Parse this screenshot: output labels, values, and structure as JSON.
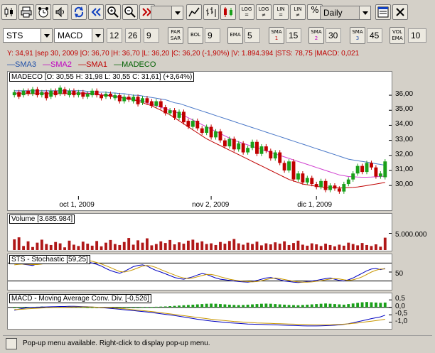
{
  "toolbar": {
    "period": "Daily",
    "zoom_value": "",
    "buttons": [
      {
        "name": "log-eq-button",
        "line1": "LOG",
        "line2": "="
      },
      {
        "name": "log-neq-button",
        "line1": "LOG",
        "line2": "≠"
      },
      {
        "name": "lin-eq-button",
        "line1": "LIN",
        "line2": "="
      },
      {
        "name": "lin-neq-button",
        "line1": "LIN",
        "line2": "≠"
      }
    ],
    "percent_label": "%"
  },
  "indicators": {
    "symbol": "STS",
    "macd_select": "MACD",
    "macd_p1": "12",
    "macd_p2": "26",
    "macd_p3": "9",
    "par_sar_l1": "PAR",
    "par_sar_l2": "SAR",
    "bol_label": "BOL",
    "bol_value": "9",
    "ema_label": "EMA",
    "ema_value": "5",
    "sma1_label": "SMA",
    "sma1_idx": "1",
    "sma1_value": "15",
    "sma2_label": "SMA",
    "sma2_idx": "2",
    "sma2_value": "30",
    "sma3_label": "SMA",
    "sma3_idx": "3",
    "sma3_value": "45",
    "vol_ema_l1": "VOL",
    "vol_ema_l2": "EMA",
    "vol_ema_value": "10"
  },
  "info_line": "Y: 34,91 |sep 30, 2009 |O: 36,70 |H: 36,70 |L: 36,20 |C: 36,20 (-1,90%) |V: 1.894.394 |STS: 78,75 |MACD: 0,021",
  "legend": [
    {
      "label": "—SMA3",
      "color": "#1f4fa8"
    },
    {
      "label": "—SMA2",
      "color": "#c000c0"
    },
    {
      "label": "—SMA1",
      "color": "#c00000"
    },
    {
      "label": "—MADECO",
      "color": "#006000"
    }
  ],
  "colors": {
    "up": "#1aa01a",
    "down": "#c00000",
    "sma3": "#4a78c8",
    "sma2": "#d040d0",
    "sma1": "#c00000"
  },
  "chart_data": [
    {
      "type": "candlestick",
      "title": "MADECO [O: 30,55  H: 31,98  L: 30,55  C: 31,61] (+3,64%)",
      "ylim": [
        29.3,
        36.9
      ],
      "yticks": [
        "36,00",
        "35,00",
        "34,00",
        "33,00",
        "32,00",
        "31,00",
        "30,00"
      ],
      "ytick_values": [
        36,
        35,
        34,
        33,
        32,
        31,
        30
      ],
      "xticks": [
        "oct 1, 2009",
        "nov 2, 2009",
        "dic 1, 2009"
      ],
      "xtick_index": [
        14,
        43,
        66
      ],
      "close": [
        36.2,
        35.9,
        36.3,
        36.1,
        36.4,
        36.0,
        36.2,
        35.8,
        36.3,
        36.0,
        36.5,
        36.1,
        36.3,
        36.0,
        36.2,
        35.9,
        36.1,
        36.3,
        36.0,
        35.8,
        36.1,
        35.9,
        36.0,
        35.6,
        35.9,
        35.7,
        35.9,
        35.4,
        35.8,
        35.5,
        35.3,
        35.6,
        35.2,
        34.8,
        35.0,
        34.5,
        34.9,
        34.2,
        33.9,
        34.3,
        33.8,
        33.5,
        33.9,
        33.2,
        33.6,
        33.0,
        32.6,
        33.1,
        32.4,
        32.8,
        32.2,
        32.5,
        32.9,
        32.1,
        32.6,
        32.3,
        31.8,
        32.2,
        31.5,
        31.0,
        31.6,
        30.4,
        30.8,
        30.2,
        30.5,
        30.1,
        29.9,
        30.3,
        29.7,
        30.0,
        29.8,
        29.6,
        30.1,
        30.4,
        30.8,
        31.3,
        30.9,
        31.5,
        31.2,
        30.6,
        30.8,
        31.6
      ],
      "open": [
        36.0,
        36.2,
        36.0,
        36.3,
        36.1,
        36.4,
        36.0,
        36.2,
        35.9,
        36.3,
        36.1,
        36.4,
        36.0,
        36.3,
        36.0,
        36.2,
        35.9,
        36.0,
        36.3,
        36.0,
        35.9,
        36.1,
        35.8,
        36.0,
        35.6,
        35.9,
        35.6,
        35.9,
        35.5,
        35.8,
        35.6,
        35.3,
        35.6,
        35.2,
        34.8,
        35.0,
        34.5,
        34.9,
        34.3,
        33.9,
        34.3,
        33.8,
        33.5,
        33.9,
        33.2,
        33.6,
        33.0,
        32.6,
        33.1,
        32.4,
        32.8,
        32.2,
        32.5,
        32.9,
        32.1,
        32.6,
        32.3,
        31.8,
        32.2,
        31.5,
        31.0,
        31.6,
        30.4,
        30.8,
        30.2,
        30.5,
        30.1,
        29.9,
        30.3,
        29.7,
        30.0,
        29.8,
        29.6,
        30.1,
        30.4,
        30.8,
        31.3,
        30.9,
        31.5,
        31.2,
        30.6,
        30.55
      ],
      "series": [
        {
          "name": "SMA3",
          "values": [
            36.3,
            36.3,
            36.3,
            36.3,
            36.3,
            36.3,
            36.3,
            36.3,
            36.3,
            36.3,
            36.3,
            36.3,
            36.3,
            36.3,
            36.3,
            36.3,
            36.25,
            36.25,
            36.2,
            36.2,
            36.2,
            36.15,
            36.15,
            36.1,
            36.1,
            36.05,
            36.0,
            36.0,
            35.95,
            35.9,
            35.85,
            35.8,
            35.75,
            35.7,
            35.6,
            35.5,
            35.45,
            35.35,
            35.25,
            35.15,
            35.05,
            34.95,
            34.85,
            34.75,
            34.65,
            34.55,
            34.45,
            34.35,
            34.25,
            34.15,
            34.05,
            33.95,
            33.85,
            33.75,
            33.65,
            33.55,
            33.45,
            33.35,
            33.25,
            33.15,
            33.05,
            32.95,
            32.85,
            32.75,
            32.65,
            32.55,
            32.45,
            32.35,
            32.25,
            32.15,
            32.05,
            31.95,
            31.85,
            31.75,
            31.7,
            31.65,
            31.6,
            31.55,
            31.5,
            31.45,
            31.4,
            31.35
          ]
        },
        {
          "name": "SMA2",
          "values": [
            36.2,
            36.2,
            36.2,
            36.2,
            36.2,
            36.2,
            36.2,
            36.2,
            36.2,
            36.2,
            36.2,
            36.2,
            36.2,
            36.2,
            36.2,
            36.15,
            36.15,
            36.1,
            36.1,
            36.05,
            36.0,
            36.0,
            35.95,
            35.9,
            35.85,
            35.8,
            35.75,
            35.7,
            35.6,
            35.5,
            35.4,
            35.3,
            35.2,
            35.1,
            35.0,
            34.9,
            34.8,
            34.65,
            34.5,
            34.35,
            34.2,
            34.05,
            33.9,
            33.75,
            33.6,
            33.45,
            33.3,
            33.15,
            33.0,
            32.9,
            32.8,
            32.7,
            32.6,
            32.5,
            32.4,
            32.3,
            32.2,
            32.1,
            32.0,
            31.9,
            31.8,
            31.7,
            31.6,
            31.5,
            31.4,
            31.3,
            31.2,
            31.1,
            31.0,
            30.9,
            30.8,
            30.7,
            30.65,
            30.6,
            30.58,
            30.56,
            30.55,
            30.55,
            30.56,
            30.58,
            30.6,
            30.62
          ]
        },
        {
          "name": "SMA1",
          "values": [
            36.1,
            36.1,
            36.1,
            36.1,
            36.1,
            36.1,
            36.1,
            36.1,
            36.1,
            36.1,
            36.1,
            36.1,
            36.1,
            36.1,
            36.1,
            36.1,
            36.1,
            36.1,
            36.05,
            36.0,
            36.0,
            35.95,
            35.9,
            35.85,
            35.8,
            35.75,
            35.7,
            35.6,
            35.5,
            35.4,
            35.3,
            35.15,
            35.0,
            34.85,
            34.7,
            34.5,
            34.3,
            34.1,
            33.9,
            33.7,
            33.5,
            33.3,
            33.1,
            32.95,
            32.8,
            32.65,
            32.5,
            32.35,
            32.2,
            32.05,
            31.9,
            31.75,
            31.6,
            31.45,
            31.3,
            31.15,
            31.0,
            30.85,
            30.7,
            30.55,
            30.4,
            30.3,
            30.2,
            30.1,
            30.05,
            30.0,
            29.95,
            29.9,
            29.88,
            29.86,
            29.85,
            29.84,
            29.84,
            29.85,
            29.87,
            29.9,
            29.95,
            30.0,
            30.05,
            30.1,
            30.15,
            30.2
          ]
        }
      ]
    },
    {
      "type": "bar",
      "title": "Volume [3.685.984]",
      "ylabel_tick": "5.000.000",
      "ytick_value": 5000000,
      "ylim": [
        0,
        10000000
      ],
      "values": [
        3.2,
        3.8,
        1.2,
        2.6,
        0.9,
        2.2,
        3.1,
        1.8,
        1.5,
        2.4,
        2.0,
        0.8,
        2.8,
        1.6,
        1.2,
        2.5,
        1.9,
        1.3,
        2.7,
        1.1,
        2.2,
        3.0,
        1.8,
        1.5,
        2.4,
        3.6,
        1.6,
        2.9,
        2.2,
        3.5,
        1.4,
        1.8,
        2.6,
        2.1,
        3.0,
        1.7,
        2.3,
        1.9,
        2.8,
        3.1,
        2.2,
        2.6,
        1.8,
        2.0,
        1.5,
        2.4,
        1.9,
        2.7,
        3.3,
        2.0,
        1.6,
        2.2,
        1.8,
        2.5,
        1.4,
        2.0,
        1.7,
        2.3,
        1.9,
        2.6,
        1.5,
        2.1,
        2.8,
        1.6,
        1.3,
        2.0,
        1.7,
        1.2,
        1.9,
        1.5,
        1.1,
        1.6,
        1.3,
        2.2,
        1.8,
        1.4,
        2.1,
        1.5,
        1.2,
        1.7,
        1.0,
        3.7
      ]
    },
    {
      "type": "line",
      "title": "STS - Stochastic [59,25]",
      "ylim": [
        0,
        100
      ],
      "ytick": "50",
      "ytick_value": 50,
      "levels": [
        80,
        20
      ],
      "series": [
        {
          "name": "K",
          "color": "#0000c0",
          "values": [
            78,
            80,
            76,
            74,
            72,
            78,
            82,
            85,
            83,
            84,
            88,
            90,
            92,
            95,
            92,
            88,
            84,
            80,
            76,
            70,
            62,
            55,
            50,
            46,
            52,
            60,
            68,
            72,
            74,
            70,
            62,
            55,
            50,
            44,
            38,
            32,
            28,
            26,
            30,
            34,
            40,
            45,
            42,
            36,
            30,
            26,
            24,
            22,
            20,
            18,
            17,
            16,
            18,
            22,
            26,
            30,
            32,
            28,
            24,
            20,
            18,
            16,
            15,
            16,
            18,
            20,
            22,
            25,
            28,
            30,
            26,
            22,
            20,
            24,
            30,
            38,
            46,
            54,
            60,
            62,
            58,
            62
          ]
        },
        {
          "name": "D",
          "color": "#c89600",
          "values": [
            74,
            76,
            77,
            76,
            75,
            75,
            77,
            80,
            82,
            83,
            85,
            87,
            89,
            91,
            92,
            91,
            89,
            86,
            82,
            77,
            71,
            65,
            58,
            52,
            50,
            53,
            58,
            64,
            70,
            72,
            70,
            65,
            58,
            52,
            46,
            40,
            34,
            30,
            28,
            30,
            34,
            38,
            42,
            42,
            39,
            34,
            30,
            26,
            23,
            21,
            19,
            18,
            17,
            18,
            21,
            25,
            28,
            30,
            28,
            25,
            22,
            19,
            17,
            16,
            16,
            17,
            19,
            21,
            24,
            27,
            28,
            27,
            24,
            22,
            24,
            28,
            34,
            42,
            50,
            56,
            60,
            60
          ]
        }
      ]
    },
    {
      "type": "bar+line",
      "title": "MACD - Moving Average Conv. Div. [-0,526]",
      "ylim": [
        -1.35,
        0.75
      ],
      "yticks": [
        "0,5",
        "0,0",
        "-0,5",
        "-1,0"
      ],
      "ytick_values": [
        0.5,
        0.0,
        -0.5,
        -1.0
      ],
      "histogram": [
        -0.05,
        -0.02,
        0.01,
        0.03,
        0.02,
        0.04,
        0.05,
        0.03,
        0.02,
        0.04,
        0.05,
        0.06,
        0.05,
        0.04,
        0.03,
        0.02,
        0.0,
        -0.02,
        -0.03,
        -0.04,
        -0.05,
        -0.06,
        -0.05,
        -0.04,
        -0.03,
        -0.02,
        -0.01,
        0.0,
        0.01,
        0.02,
        0.03,
        0.04,
        0.05,
        0.06,
        0.08,
        0.1,
        0.12,
        0.14,
        0.16,
        0.18,
        0.2,
        0.22,
        0.24,
        0.25,
        0.24,
        0.22,
        0.2,
        0.18,
        0.16,
        0.15,
        0.16,
        0.18,
        0.2,
        0.22,
        0.24,
        0.25,
        0.24,
        0.22,
        0.2,
        0.18,
        0.16,
        0.15,
        0.14,
        0.16,
        0.18,
        0.2,
        0.22,
        0.24,
        0.26,
        0.24,
        0.22,
        0.2,
        0.18,
        0.22,
        0.26,
        0.3,
        0.34,
        0.36,
        0.34,
        0.32,
        0.3,
        0.32
      ],
      "series": [
        {
          "name": "MACD",
          "color": "#0000c0",
          "values": [
            -0.2,
            -0.12,
            -0.06,
            -0.02,
            0.0,
            0.01,
            0.02,
            0.03,
            0.04,
            0.05,
            0.06,
            0.06,
            0.07,
            0.07,
            0.06,
            0.05,
            0.04,
            0.02,
            0.0,
            -0.02,
            -0.04,
            -0.07,
            -0.1,
            -0.13,
            -0.16,
            -0.19,
            -0.22,
            -0.25,
            -0.28,
            -0.31,
            -0.35,
            -0.39,
            -0.43,
            -0.47,
            -0.51,
            -0.55,
            -0.6,
            -0.65,
            -0.7,
            -0.75,
            -0.8,
            -0.84,
            -0.88,
            -0.92,
            -0.95,
            -0.98,
            -1.01,
            -1.04,
            -1.06,
            -1.08,
            -1.1,
            -1.12,
            -1.13,
            -1.14,
            -1.15,
            -1.16,
            -1.17,
            -1.18,
            -1.19,
            -1.2,
            -1.21,
            -1.22,
            -1.23,
            -1.24,
            -1.25,
            -1.25,
            -1.25,
            -1.24,
            -1.23,
            -1.22,
            -1.2,
            -1.18,
            -1.15,
            -1.1,
            -1.04,
            -0.97,
            -0.9,
            -0.83,
            -0.76,
            -0.7,
            -0.64,
            -0.53
          ]
        },
        {
          "name": "Signal",
          "color": "#c89600",
          "values": [
            -0.15,
            -0.14,
            -0.12,
            -0.1,
            -0.08,
            -0.06,
            -0.04,
            -0.03,
            -0.02,
            -0.01,
            0.0,
            0.01,
            0.02,
            0.03,
            0.03,
            0.03,
            0.03,
            0.02,
            0.01,
            0.0,
            -0.01,
            -0.03,
            -0.05,
            -0.07,
            -0.1,
            -0.13,
            -0.16,
            -0.19,
            -0.22,
            -0.25,
            -0.28,
            -0.32,
            -0.36,
            -0.4,
            -0.44,
            -0.48,
            -0.52,
            -0.56,
            -0.6,
            -0.64,
            -0.68,
            -0.72,
            -0.76,
            -0.8,
            -0.83,
            -0.86,
            -0.89,
            -0.92,
            -0.95,
            -0.97,
            -0.99,
            -1.01,
            -1.03,
            -1.05,
            -1.06,
            -1.07,
            -1.08,
            -1.09,
            -1.1,
            -1.11,
            -1.12,
            -1.13,
            -1.14,
            -1.15,
            -1.16,
            -1.17,
            -1.18,
            -1.18,
            -1.18,
            -1.17,
            -1.16,
            -1.15,
            -1.13,
            -1.11,
            -1.08,
            -1.05,
            -1.01,
            -0.97,
            -0.93,
            -0.89,
            -0.85,
            -0.8
          ]
        }
      ]
    }
  ],
  "status": "Pop-up menu available. Right-click to display pop-up menu."
}
